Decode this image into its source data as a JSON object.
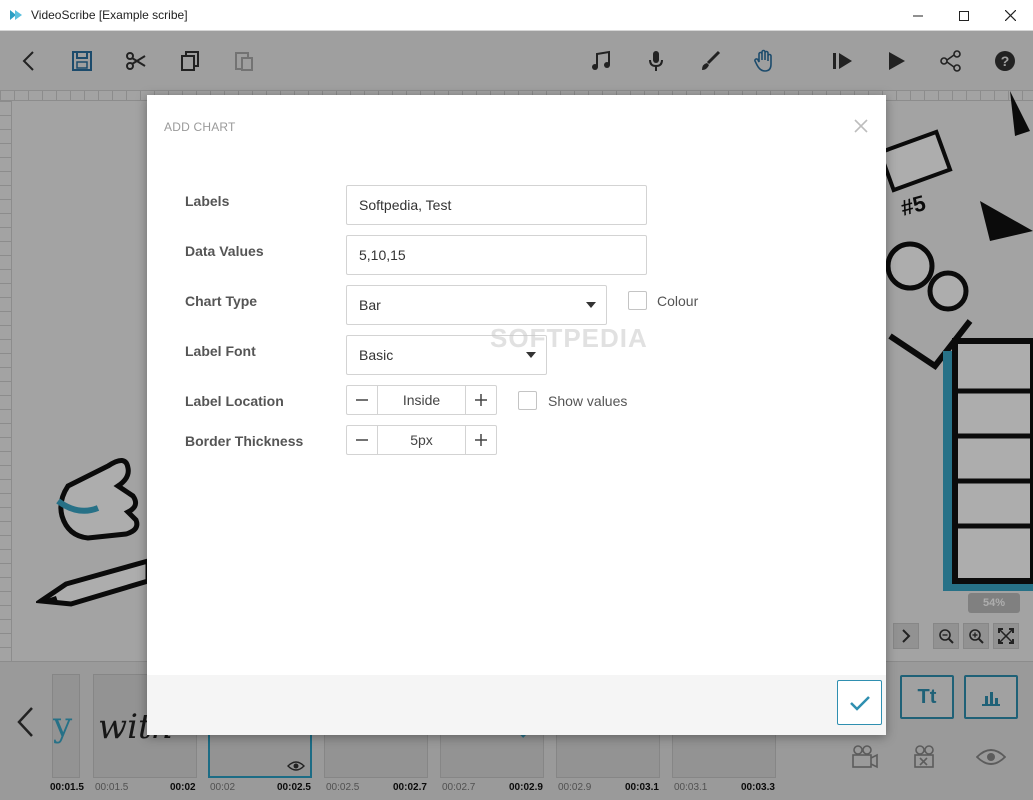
{
  "window": {
    "title": "VideoScribe [Example scribe]"
  },
  "toolbar": {
    "icons": [
      "back-icon",
      "save-icon",
      "cut-icon",
      "copy-icon",
      "paste-icon",
      "music-icon",
      "microphone-icon",
      "brush-icon",
      "hand-icon",
      "preview-from-icon",
      "play-icon",
      "share-icon",
      "help-icon"
    ]
  },
  "canvas": {
    "zoom": "54%"
  },
  "timeline": {
    "thumbnails": [
      {
        "start": "",
        "end": "00:01.5"
      },
      {
        "start": "00:01.5",
        "end": "00:02"
      },
      {
        "start": "00:02",
        "end": "00:02.5"
      },
      {
        "start": "00:02.5",
        "end": "00:02.7"
      },
      {
        "start": "00:02.7",
        "end": "00:02.9"
      },
      {
        "start": "00:02.9",
        "end": "00:03.1"
      },
      {
        "start": "00:03.1",
        "end": "00:03.3"
      }
    ],
    "thumbnail_text": "with",
    "thumbnail_text_partial": "y",
    "text_button_label": "Tt"
  },
  "dialog": {
    "title": "ADD CHART",
    "labels_label": "Labels",
    "labels_value": "Softpedia, Test",
    "data_values_label": "Data Values",
    "data_values_value": "5,10,15",
    "chart_type_label": "Chart Type",
    "chart_type_value": "Bar",
    "colour_label": "Colour",
    "label_font_label": "Label Font",
    "label_font_value": "Basic",
    "label_location_label": "Label Location",
    "label_location_value": "Inside",
    "show_values_label": "Show values",
    "border_thickness_label": "Border Thickness",
    "border_thickness_value": "5px",
    "watermark": "SOFTPEDIA"
  },
  "colors": {
    "accent": "#2f8fb0",
    "overlay": "rgba(0,0,0,0.32)"
  }
}
